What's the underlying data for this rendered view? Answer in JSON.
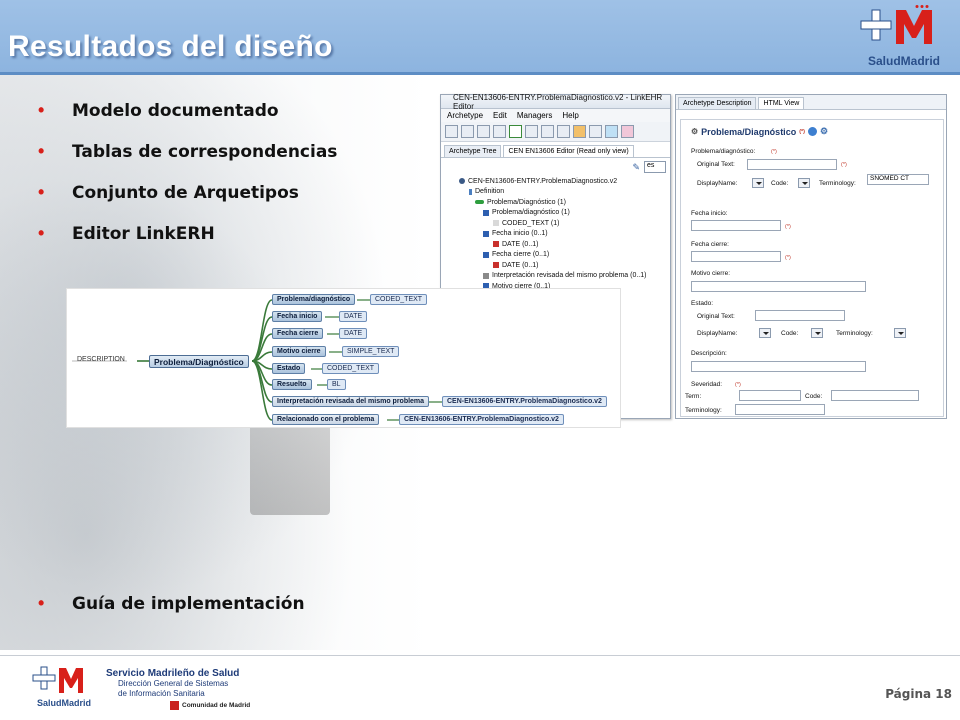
{
  "header": {
    "title": "Resultados del diseño",
    "logo_text": "SaludMadrid"
  },
  "bullets_top": [
    "Modelo documentado",
    "Tablas de correspondencias",
    "Conjunto de Arquetipos",
    "Editor LinkERH"
  ],
  "bullet_bottom": "Guía de implementación",
  "editor": {
    "window_title": "CEN-EN13606-ENTRY.ProblemaDiagnostico.v2 - LinkEHR Editor",
    "menu": [
      "Archetype",
      "Edit",
      "Managers",
      "Help"
    ],
    "tabs": [
      "Archetype Tree",
      "CEN EN13606 Editor (Read only view)"
    ],
    "lang": "es",
    "tree": [
      "CEN-EN13606-ENTRY.ProblemaDiagnostico.v2",
      "Definition",
      "Problema/Diagnóstico (1)",
      "Problema/diagnóstico (1)",
      "CODED_TEXT (1)",
      "Fecha inicio (0..1)",
      "DATE (0..1)",
      "Fecha cierre (0..1)",
      "DATE (0..1)",
      "Interpretación revisada del mismo problema (0..1)",
      "Motivo cierre (0..1)"
    ]
  },
  "mindmap": {
    "root_desc": "DESCRIPTION",
    "main": "Problema/Diagnóstico",
    "branches": [
      {
        "label": "Problema/diagnóstico",
        "type": "CODED_TEXT"
      },
      {
        "label": "Fecha inicio",
        "type": "DATE"
      },
      {
        "label": "Fecha cierre",
        "type": "DATE"
      },
      {
        "label": "Motivo cierre",
        "type": "SIMPLE_TEXT"
      },
      {
        "label": "Estado",
        "type": "CODED_TEXT"
      },
      {
        "label": "Resuelto",
        "type": "BL"
      },
      {
        "label": "Interpretación revisada del mismo problema",
        "type": "CEN-EN13606-ENTRY.ProblemaDiagnostico.v2"
      },
      {
        "label": "Relacionado con el problema",
        "type": "CEN-EN13606-ENTRY.ProblemaDiagnostico.v2"
      }
    ]
  },
  "htmlview": {
    "tabs": [
      "Archetype Description",
      "HTML View"
    ],
    "heading": "Problema/Diagnóstico",
    "required_mark": "(*)",
    "labels": {
      "problema": "Problema/diagnóstico:",
      "original_text": "Original Text:",
      "displayname": "DisplayName:",
      "code": "Code:",
      "terminology": "Terminology:",
      "terminology_value": "SNOMED CT",
      "fecha_inicio": "Fecha inicio:",
      "fecha_cierre": "Fecha cierre:",
      "motivo_cierre": "Motivo cierre:",
      "estado": "Estado:",
      "descripcion": "Descripción:",
      "severidad": "Severidad:",
      "term": "Term:",
      "code2": "Code:",
      "terminology2": "Terminology:"
    }
  },
  "footer": {
    "logo_text": "SaludMadrid",
    "org_name": "Servicio Madrileño de Salud",
    "org_line1": "Dirección General de Sistemas",
    "org_line2": "de Información Sanitaria",
    "comunidad": "Comunidad de Madrid",
    "page": "Página 18"
  },
  "colors": {
    "header_blue": "#8db4df",
    "bullet_red": "#d8201a",
    "brand_red": "#d8201a",
    "brand_blue": "#2a4f8a"
  }
}
